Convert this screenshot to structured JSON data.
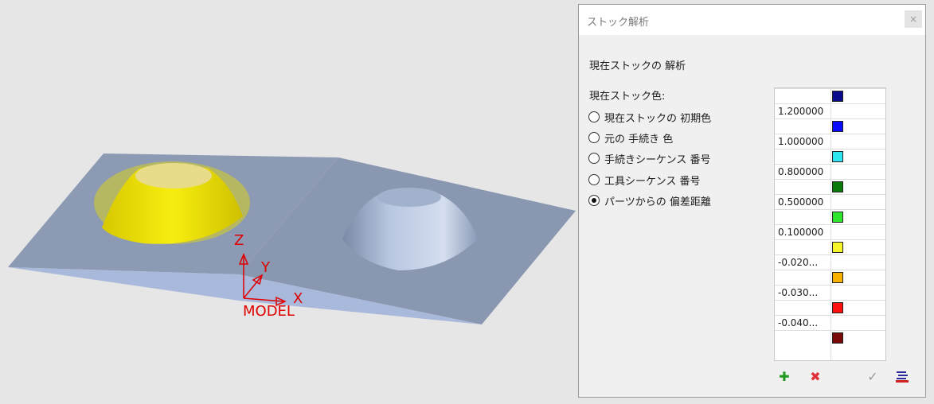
{
  "viewport": {
    "axis_labels": {
      "x": "X",
      "y": "Y",
      "z": "Z",
      "model": "MODEL"
    }
  },
  "dialog": {
    "title": "ストック解析",
    "close_label": "×",
    "section_title": "現在ストックの 解析",
    "color_label": "現在ストック色:",
    "options": [
      {
        "label": "現在ストックの 初期色",
        "checked": false
      },
      {
        "label": "元の 手続き 色",
        "checked": false
      },
      {
        "label": "手続きシーケンス 番号",
        "checked": false
      },
      {
        "label": "工具シーケンス 番号",
        "checked": false
      },
      {
        "label": "パーツからの 偏差距離",
        "checked": true
      }
    ],
    "legend": {
      "values": [
        "1.200000",
        "1.000000",
        "0.800000",
        "0.500000",
        "0.100000",
        "-0.020...",
        "-0.030...",
        "-0.040..."
      ],
      "colors": [
        "#0a0a8c",
        "#0a0aff",
        "#2ee6f0",
        "#0a7a0a",
        "#2ee62e",
        "#f5f52a",
        "#f5b000",
        "#ff1010",
        "#7a0a0a"
      ]
    },
    "toolbar": {
      "add_icon": "plus-icon",
      "remove_icon": "delete-x-icon",
      "apply_icon": "checkmark-icon",
      "settings_icon": "list-settings-icon"
    }
  }
}
